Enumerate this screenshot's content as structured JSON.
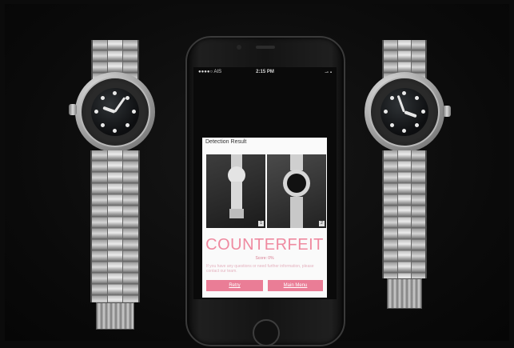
{
  "phone": {
    "status": {
      "carrier": "●●●●○ AIS",
      "time": "2:15 PM",
      "right": "⇀ ▪"
    },
    "card": {
      "title": "Detection Result",
      "thumb_1_number": "1",
      "thumb_2_number": "2",
      "verdict": "COUNTERFEIT",
      "score": "Score: 0%",
      "note": "If you have any questions or need further information, please contact our team.",
      "retry_label": "Retry",
      "menu_label": "Main Menu"
    },
    "icons": {
      "help": "question-circle-icon",
      "box": "cube-icon"
    },
    "colors": {
      "accent": "#ea7d96",
      "verdict": "#ef8aa0"
    }
  }
}
